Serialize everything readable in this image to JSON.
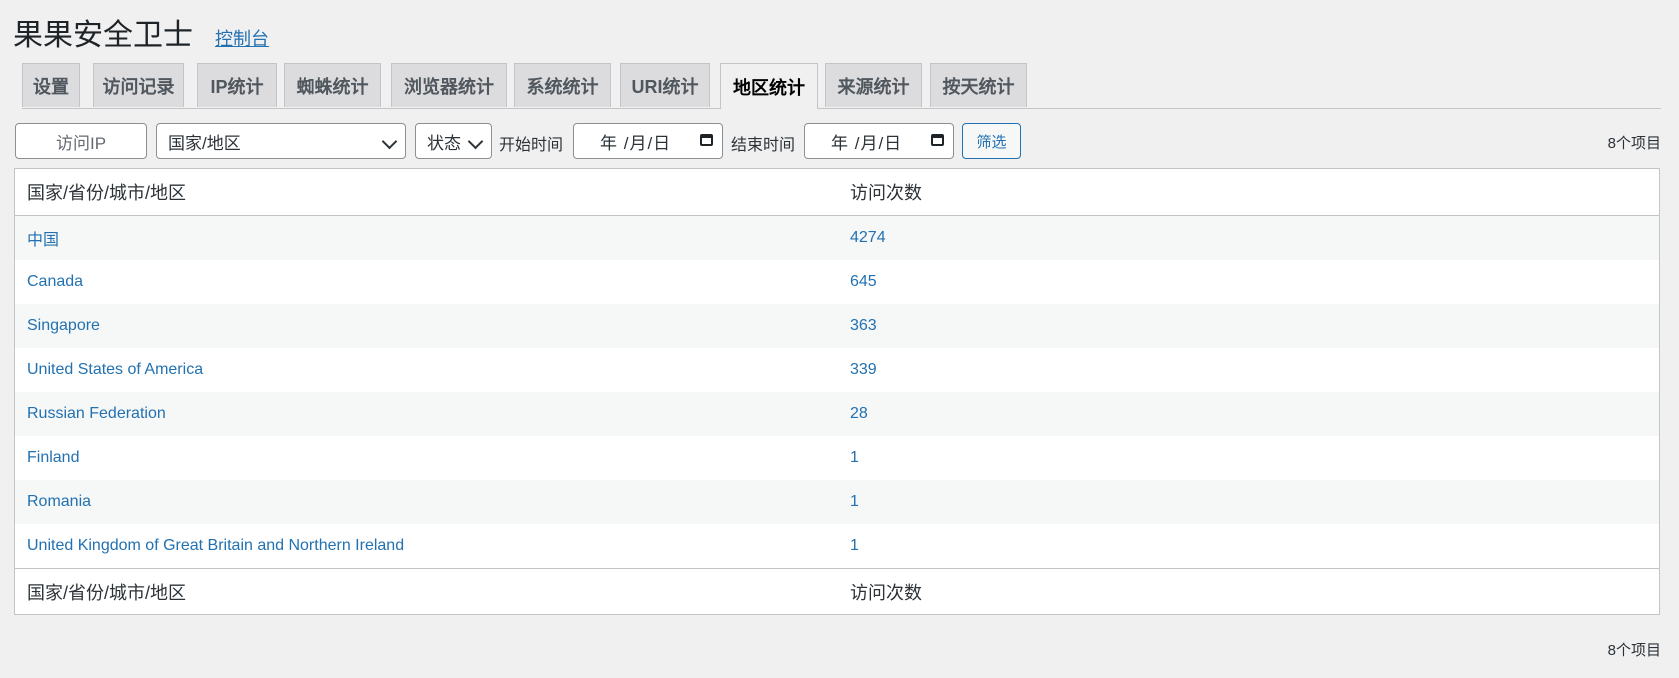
{
  "header": {
    "title": "果果安全卫士",
    "console_link": "控制台"
  },
  "tabs": [
    {
      "label": "设置",
      "active": false
    },
    {
      "label": "访问记录",
      "active": false
    },
    {
      "label": "IP统计",
      "active": false
    },
    {
      "label": "蜘蛛统计",
      "active": false
    },
    {
      "label": "浏览器统计",
      "active": false
    },
    {
      "label": "系统统计",
      "active": false
    },
    {
      "label": "URI统计",
      "active": false
    },
    {
      "label": "地区统计",
      "active": true
    },
    {
      "label": "来源统计",
      "active": false
    },
    {
      "label": "按天统计",
      "active": false
    }
  ],
  "filters": {
    "ip_placeholder": "访问IP",
    "region_value": "国家/地区",
    "status_value": "状态",
    "start_label": "开始时间",
    "start_value": "年 /月/日",
    "end_label": "结束时间",
    "end_value": "年 /月/日",
    "filter_button": "筛选",
    "item_count": "8个项目"
  },
  "table": {
    "columns": [
      "国家/省份/城市/地区",
      "访问次数"
    ],
    "rows": [
      {
        "region": "中国",
        "visits": "4274"
      },
      {
        "region": "Canada",
        "visits": "645"
      },
      {
        "region": "Singapore",
        "visits": "363"
      },
      {
        "region": "United States of America",
        "visits": "339"
      },
      {
        "region": "Russian Federation",
        "visits": "28"
      },
      {
        "region": "Finland",
        "visits": "1"
      },
      {
        "region": "Romania",
        "visits": "1"
      },
      {
        "region": "United Kingdom of Great Britain and Northern Ireland",
        "visits": "1"
      }
    ]
  },
  "colors": {
    "link": "#2271b1",
    "background": "#f0f0f1",
    "tab_inactive": "#dcdcde"
  }
}
